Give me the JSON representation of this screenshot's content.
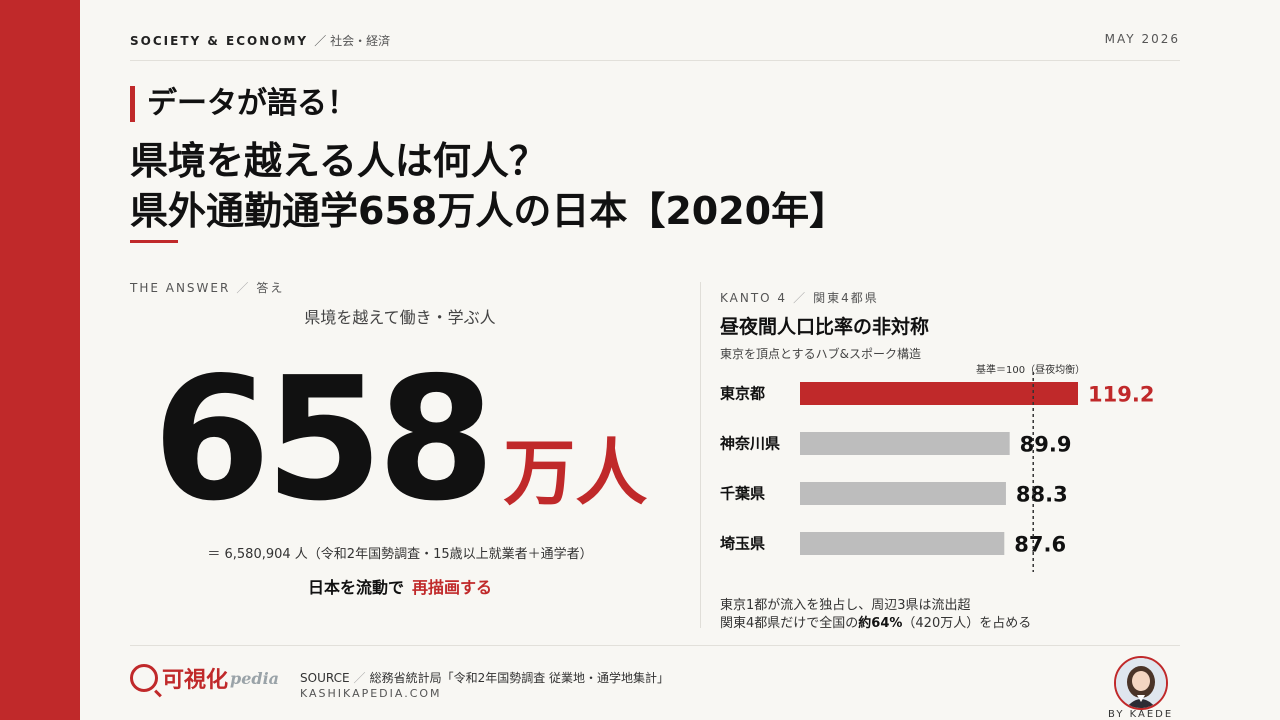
{
  "header": {
    "category": "SOCIETY & ECONOMY",
    "category_sub": "社会・経済",
    "date": "MAY 2026"
  },
  "kicker": "データが語る！",
  "title": {
    "line1": "県境を越える人は何人？",
    "line2": "県外通勤通学658万人の日本【2020年】"
  },
  "answer": {
    "section_label": "THE ANSWER",
    "section_sub": "答え",
    "caption": "県境を越えて働き・学ぶ人",
    "big_number": "658",
    "unit": "万人",
    "exact": "＝ 6,580,904 人（令和2年国勢調査・15歳以上就業者＋通学者）",
    "cta_prefix": "日本を流動で",
    "cta_highlight": "再描画する"
  },
  "kanto": {
    "section_label": "KANTO 4",
    "section_sub": "関東4都県",
    "chart_title": "昼夜間人口比率の非対称",
    "chart_subtitle": "東京を頂点とするハブ&スポーク構造",
    "baseline_label": "基準＝100（昼夜均衡）",
    "note_line1": "東京1都が流入を独占し、周辺3県は流出超",
    "note_line2_pre": "関東4都県だけで全国の",
    "note_line2_bold": "約64%",
    "note_line2_post": "（420万人）を占める"
  },
  "chart_data": {
    "type": "bar",
    "orientation": "horizontal",
    "categories": [
      "東京都",
      "神奈川県",
      "千葉県",
      "埼玉県"
    ],
    "values": [
      119.2,
      89.9,
      88.3,
      87.6
    ],
    "value_labels": [
      "119.2",
      "89.9",
      "88.3",
      "87.6"
    ],
    "reference_line": 100,
    "title": "昼夜間人口比率の非対称",
    "colors": {
      "highlight": "#c0292a",
      "other": "#bdbdbd"
    }
  },
  "footer": {
    "logo_text": "可視化",
    "logo_pedia": "pedia",
    "source_label": "SOURCE",
    "source_text": "総務省統計局「令和2年国勢調査 従業地・通学地集計」",
    "site": "KASHIKAPEDIA.COM",
    "byline": "BY KAEDE"
  },
  "colors": {
    "accent": "#c0292a",
    "background": "#f8f7f3"
  }
}
